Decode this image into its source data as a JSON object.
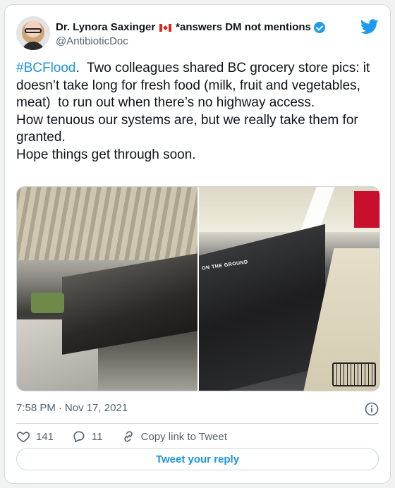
{
  "author": {
    "display_name": "Dr. Lynora Saxinger",
    "name_suffix": "*answers DM not mentions",
    "handle": "@AntibioticDoc"
  },
  "tweet": {
    "hashtag": "#BCFlood",
    "text_after_hashtag": ".  Two colleagues shared BC grocery store pics: it doesn’t take long for fresh food (milk, fruit and vegetables, meat)  to run out when there’s no highway access.\nHow tenuous our systems are, but we really take them for granted.\nHope things get through soon."
  },
  "media": {
    "right_photo_label": "ON THE GROUND"
  },
  "meta": {
    "time": "7:58 PM",
    "separator": "·",
    "date": "Nov 17, 2021"
  },
  "actions": {
    "likes": "141",
    "replies": "11",
    "copy_link": "Copy link to Tweet"
  },
  "reply_button": "Tweet your reply",
  "icons": {
    "brand": "twitter-bird-icon",
    "verified": "verified-badge-icon",
    "like": "heart-icon",
    "reply": "speech-bubble-icon",
    "link": "link-icon",
    "info": "info-icon"
  },
  "colors": {
    "brand": "#1d9bf0",
    "link": "#1b95e0",
    "muted": "#536471",
    "border": "#cfd9de"
  }
}
